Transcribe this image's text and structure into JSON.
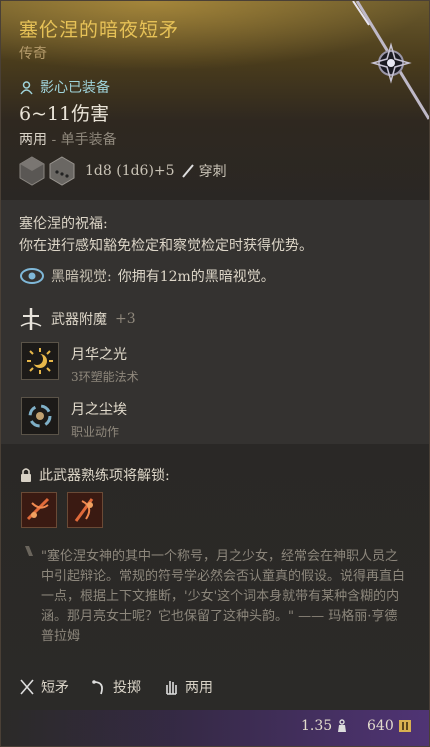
{
  "item": {
    "title": "塞伦涅的暗夜短矛",
    "rarity": "传奇",
    "equipped": "影心已装备",
    "damage": "6~11伤害",
    "hands": "两用",
    "hands_sub": "- 单手装备",
    "dice_formula": "1d8 (1d6)+5",
    "damage_type": "穿刺"
  },
  "blessing": {
    "title": "塞伦涅的祝福:",
    "text": "你在进行感知豁免检定和察觉检定时获得优势。"
  },
  "darkvision": {
    "label": "黑暗视觉:",
    "text": "你拥有12m的黑暗视觉。"
  },
  "enchant": {
    "label": "武器附魔",
    "bonus": "+3"
  },
  "spells": [
    {
      "name": "月华之光",
      "desc": "3环塑能法术"
    },
    {
      "name": "月之尘埃",
      "desc": "职业动作"
    }
  ],
  "unlock": {
    "title": "此武器熟练项将解锁:"
  },
  "quote": "\"塞伦涅女神的其中一个称号，月之少女，经常会在神职人员之中引起辩论。常规的符号学必然会否认童真的假设。说得再直白一点，根据上下文推断，'少女'这个词本身就带有某种含糊的内涵。那月亮女士呢？它也保留了这种头韵。\" —— 玛格丽·亨德普拉姆",
  "properties": [
    "短矛",
    "投掷",
    "两用"
  ],
  "footer": {
    "weight": "1.35",
    "price": "640"
  },
  "colors": {
    "title": "#e7c257",
    "equipped": "#9fd3da"
  },
  "icons": [
    "shadowheart-equipped-icon",
    "dice-icon",
    "pierce-icon",
    "darkvision-icon",
    "enchant-icon",
    "moonbeam-icon",
    "moondust-icon",
    "lock-icon",
    "weapon-skill-icon",
    "quote-icon",
    "spear-icon",
    "throw-icon",
    "versatile-hand-icon",
    "weight-icon",
    "gold-icon"
  ]
}
